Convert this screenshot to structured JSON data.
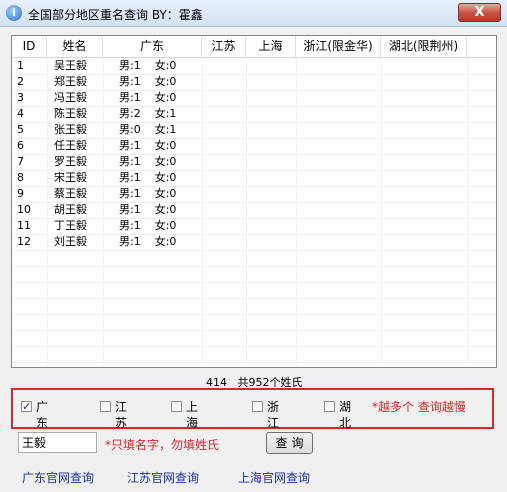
{
  "window": {
    "title": "全国部分地区重名查询    BY：霍鑫",
    "close_label": "X"
  },
  "table": {
    "headers": [
      "ID",
      "姓名",
      "广东",
      "江苏",
      "上海",
      "浙江(限金华)",
      "湖北(限荆州)"
    ],
    "rows": [
      {
        "id": "1",
        "name": "吴王毅",
        "gd": "男:1    女:0"
      },
      {
        "id": "2",
        "name": "郑王毅",
        "gd": "男:1    女:0"
      },
      {
        "id": "3",
        "name": "冯王毅",
        "gd": "男:1    女:0"
      },
      {
        "id": "4",
        "name": "陈王毅",
        "gd": "男:2    女:1"
      },
      {
        "id": "5",
        "name": "张王毅",
        "gd": "男:0    女:1"
      },
      {
        "id": "6",
        "name": "任王毅",
        "gd": "男:1    女:0"
      },
      {
        "id": "7",
        "name": "罗王毅",
        "gd": "男:1    女:0"
      },
      {
        "id": "8",
        "name": "宋王毅",
        "gd": "男:1    女:0"
      },
      {
        "id": "9",
        "name": "蔡王毅",
        "gd": "男:1    女:0"
      },
      {
        "id": "10",
        "name": "胡王毅",
        "gd": "男:1    女:0"
      },
      {
        "id": "11",
        "name": "丁王毅",
        "gd": "男:1    女:0"
      },
      {
        "id": "12",
        "name": "刘王毅",
        "gd": "男:1    女:0"
      }
    ]
  },
  "status": {
    "count": "414",
    "total": "共952个姓氏"
  },
  "regions": [
    {
      "label": "广东",
      "checked": true
    },
    {
      "label": "江苏",
      "checked": false
    },
    {
      "label": "上海",
      "checked": false
    },
    {
      "label": "浙江",
      "checked": false
    },
    {
      "label": "湖北",
      "checked": false
    }
  ],
  "regions_warning": "*越多个 查询越慢",
  "search": {
    "value": "王毅",
    "hint": "*只填名字，勿填姓氏",
    "button_label": "查询"
  },
  "links": [
    "广东官网查询",
    "江苏官网查询",
    "上海官网查询"
  ],
  "colors": {
    "highlight_border": "#e0242a",
    "warning_text": "#e0242a",
    "link": "#1a2fb0"
  }
}
